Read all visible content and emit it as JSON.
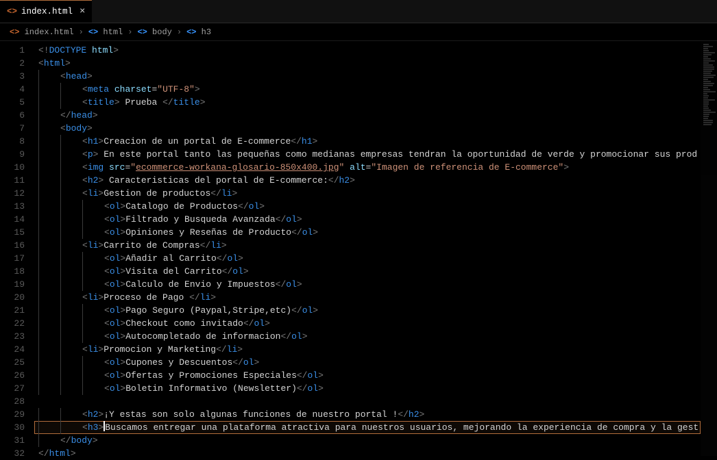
{
  "tab": {
    "filename": "index.html",
    "icon": "<>"
  },
  "breadcrumbs": [
    {
      "kind": "file",
      "icon": "<>",
      "label": "index.html"
    },
    {
      "kind": "el",
      "icon": "<>",
      "label": "html"
    },
    {
      "kind": "el",
      "icon": "<>",
      "label": "body"
    },
    {
      "kind": "el",
      "icon": "<>",
      "label": "h3"
    }
  ],
  "current_line": 30,
  "code": [
    {
      "n": 1,
      "indent": 0,
      "tokens": [
        [
          "brk",
          "<!"
        ],
        [
          "dt",
          "DOCTYPE"
        ],
        [
          "txt",
          " "
        ],
        [
          "attr",
          "html"
        ],
        [
          "brk",
          ">"
        ]
      ]
    },
    {
      "n": 2,
      "indent": 0,
      "tokens": [
        [
          "brk",
          "<"
        ],
        [
          "tag",
          "html"
        ],
        [
          "brk",
          ">"
        ]
      ]
    },
    {
      "n": 3,
      "indent": 1,
      "tokens": [
        [
          "brk",
          "<"
        ],
        [
          "tag",
          "head"
        ],
        [
          "brk",
          ">"
        ]
      ]
    },
    {
      "n": 4,
      "indent": 2,
      "tokens": [
        [
          "brk",
          "<"
        ],
        [
          "tag",
          "meta"
        ],
        [
          "txt",
          " "
        ],
        [
          "attr",
          "charset"
        ],
        [
          "eq",
          "="
        ],
        [
          "str",
          "\"UTF-8\""
        ],
        [
          "brk",
          ">"
        ]
      ]
    },
    {
      "n": 5,
      "indent": 2,
      "tokens": [
        [
          "brk",
          "<"
        ],
        [
          "tag",
          "title"
        ],
        [
          "brk",
          ">"
        ],
        [
          "txt",
          " Prueba "
        ],
        [
          "brk",
          "</"
        ],
        [
          "tag",
          "title"
        ],
        [
          "brk",
          ">"
        ]
      ]
    },
    {
      "n": 6,
      "indent": 1,
      "tokens": [
        [
          "brk",
          "</"
        ],
        [
          "tag",
          "head"
        ],
        [
          "brk",
          ">"
        ]
      ]
    },
    {
      "n": 7,
      "indent": 1,
      "tokens": [
        [
          "brk",
          "<"
        ],
        [
          "tag",
          "body"
        ],
        [
          "brk",
          ">"
        ]
      ]
    },
    {
      "n": 8,
      "indent": 2,
      "tokens": [
        [
          "brk",
          "<"
        ],
        [
          "tag",
          "h1"
        ],
        [
          "brk",
          ">"
        ],
        [
          "txt",
          "Creacion de un portal de E-commerce"
        ],
        [
          "brk",
          "</"
        ],
        [
          "tag",
          "h1"
        ],
        [
          "brk",
          ">"
        ]
      ]
    },
    {
      "n": 9,
      "indent": 2,
      "tokens": [
        [
          "brk",
          "<"
        ],
        [
          "tag",
          "p"
        ],
        [
          "brk",
          ">"
        ],
        [
          "txt",
          " En este portal tanto las pequeñas como medianas empresas tendran la oportunidad de verde y promocionar sus prod"
        ]
      ]
    },
    {
      "n": 10,
      "indent": 2,
      "tokens": [
        [
          "brk",
          "<"
        ],
        [
          "tag",
          "img"
        ],
        [
          "txt",
          " "
        ],
        [
          "attr",
          "src"
        ],
        [
          "eq",
          "="
        ],
        [
          "str",
          "\""
        ],
        [
          "str-link",
          "ecommerce-workana-glosario-850x400.jpg"
        ],
        [
          "str",
          "\""
        ],
        [
          "txt",
          " "
        ],
        [
          "attr",
          "alt"
        ],
        [
          "eq",
          "="
        ],
        [
          "str",
          "\"Imagen de referencia de E-commerce\""
        ],
        [
          "brk",
          ">"
        ]
      ]
    },
    {
      "n": 11,
      "indent": 2,
      "tokens": [
        [
          "brk",
          "<"
        ],
        [
          "tag",
          "h2"
        ],
        [
          "brk",
          ">"
        ],
        [
          "txt",
          " Caracteristicas del portal de E-commerce:"
        ],
        [
          "brk",
          "</"
        ],
        [
          "tag",
          "h2"
        ],
        [
          "brk",
          ">"
        ]
      ]
    },
    {
      "n": 12,
      "indent": 2,
      "tokens": [
        [
          "brk",
          "<"
        ],
        [
          "tag",
          "li"
        ],
        [
          "brk",
          ">"
        ],
        [
          "txt",
          "Gestion de productos"
        ],
        [
          "brk",
          "</"
        ],
        [
          "tag",
          "li"
        ],
        [
          "brk",
          ">"
        ]
      ]
    },
    {
      "n": 13,
      "indent": 3,
      "tokens": [
        [
          "brk",
          "<"
        ],
        [
          "tag",
          "ol"
        ],
        [
          "brk",
          ">"
        ],
        [
          "txt",
          "Catalogo de Productos"
        ],
        [
          "brk",
          "</"
        ],
        [
          "tag",
          "ol"
        ],
        [
          "brk",
          ">"
        ]
      ]
    },
    {
      "n": 14,
      "indent": 3,
      "tokens": [
        [
          "brk",
          "<"
        ],
        [
          "tag",
          "ol"
        ],
        [
          "brk",
          ">"
        ],
        [
          "txt",
          "Filtrado y Busqueda Avanzada"
        ],
        [
          "brk",
          "</"
        ],
        [
          "tag",
          "ol"
        ],
        [
          "brk",
          ">"
        ]
      ]
    },
    {
      "n": 15,
      "indent": 3,
      "tokens": [
        [
          "brk",
          "<"
        ],
        [
          "tag",
          "ol"
        ],
        [
          "brk",
          ">"
        ],
        [
          "txt",
          "Opiniones y Reseñas de Producto"
        ],
        [
          "brk",
          "</"
        ],
        [
          "tag",
          "ol"
        ],
        [
          "brk",
          ">"
        ]
      ]
    },
    {
      "n": 16,
      "indent": 2,
      "tokens": [
        [
          "brk",
          "<"
        ],
        [
          "tag",
          "li"
        ],
        [
          "brk",
          ">"
        ],
        [
          "txt",
          "Carrito de Compras"
        ],
        [
          "brk",
          "</"
        ],
        [
          "tag",
          "li"
        ],
        [
          "brk",
          ">"
        ]
      ]
    },
    {
      "n": 17,
      "indent": 3,
      "tokens": [
        [
          "brk",
          "<"
        ],
        [
          "tag",
          "ol"
        ],
        [
          "brk",
          ">"
        ],
        [
          "txt",
          "Añadir al Carrito"
        ],
        [
          "brk",
          "</"
        ],
        [
          "tag",
          "ol"
        ],
        [
          "brk",
          ">"
        ]
      ]
    },
    {
      "n": 18,
      "indent": 3,
      "tokens": [
        [
          "brk",
          "<"
        ],
        [
          "tag",
          "ol"
        ],
        [
          "brk",
          ">"
        ],
        [
          "txt",
          "Visita del Carrito"
        ],
        [
          "brk",
          "</"
        ],
        [
          "tag",
          "ol"
        ],
        [
          "brk",
          ">"
        ]
      ]
    },
    {
      "n": 19,
      "indent": 3,
      "tokens": [
        [
          "brk",
          "<"
        ],
        [
          "tag",
          "ol"
        ],
        [
          "brk",
          ">"
        ],
        [
          "txt",
          "Calculo de Envio y Impuestos"
        ],
        [
          "brk",
          "</"
        ],
        [
          "tag",
          "ol"
        ],
        [
          "brk",
          ">"
        ]
      ]
    },
    {
      "n": 20,
      "indent": 2,
      "tokens": [
        [
          "brk",
          "<"
        ],
        [
          "tag",
          "li"
        ],
        [
          "brk",
          ">"
        ],
        [
          "txt",
          "Proceso de Pago "
        ],
        [
          "brk",
          "</"
        ],
        [
          "tag",
          "li"
        ],
        [
          "brk",
          ">"
        ]
      ]
    },
    {
      "n": 21,
      "indent": 3,
      "tokens": [
        [
          "brk",
          "<"
        ],
        [
          "tag",
          "ol"
        ],
        [
          "brk",
          ">"
        ],
        [
          "txt",
          "Pago Seguro (Paypal,Stripe,etc)"
        ],
        [
          "brk",
          "</"
        ],
        [
          "tag",
          "ol"
        ],
        [
          "brk",
          ">"
        ]
      ]
    },
    {
      "n": 22,
      "indent": 3,
      "tokens": [
        [
          "brk",
          "<"
        ],
        [
          "tag",
          "ol"
        ],
        [
          "brk",
          ">"
        ],
        [
          "txt",
          "Checkout como invitado"
        ],
        [
          "brk",
          "</"
        ],
        [
          "tag",
          "ol"
        ],
        [
          "brk",
          ">"
        ]
      ]
    },
    {
      "n": 23,
      "indent": 3,
      "tokens": [
        [
          "brk",
          "<"
        ],
        [
          "tag",
          "ol"
        ],
        [
          "brk",
          ">"
        ],
        [
          "txt",
          "Autocompletado de informacion"
        ],
        [
          "brk",
          "</"
        ],
        [
          "tag",
          "ol"
        ],
        [
          "brk",
          ">"
        ]
      ]
    },
    {
      "n": 24,
      "indent": 2,
      "tokens": [
        [
          "brk",
          "<"
        ],
        [
          "tag",
          "li"
        ],
        [
          "brk",
          ">"
        ],
        [
          "txt",
          "Promocion y Marketing"
        ],
        [
          "brk",
          "</"
        ],
        [
          "tag",
          "li"
        ],
        [
          "brk",
          ">"
        ]
      ]
    },
    {
      "n": 25,
      "indent": 3,
      "tokens": [
        [
          "brk",
          "<"
        ],
        [
          "tag",
          "ol"
        ],
        [
          "brk",
          ">"
        ],
        [
          "txt",
          "Cupones y Descuentos"
        ],
        [
          "brk",
          "</"
        ],
        [
          "tag",
          "ol"
        ],
        [
          "brk",
          ">"
        ]
      ]
    },
    {
      "n": 26,
      "indent": 3,
      "tokens": [
        [
          "brk",
          "<"
        ],
        [
          "tag",
          "ol"
        ],
        [
          "brk",
          ">"
        ],
        [
          "txt",
          "Ofertas y Promociones Especiales"
        ],
        [
          "brk",
          "</"
        ],
        [
          "tag",
          "ol"
        ],
        [
          "brk",
          ">"
        ]
      ]
    },
    {
      "n": 27,
      "indent": 3,
      "tokens": [
        [
          "brk",
          "<"
        ],
        [
          "tag",
          "ol"
        ],
        [
          "brk",
          ">"
        ],
        [
          "txt",
          "Boletin Informativo (Newsletter)"
        ],
        [
          "brk",
          "</"
        ],
        [
          "tag",
          "ol"
        ],
        [
          "brk",
          ">"
        ]
      ]
    },
    {
      "n": 28,
      "indent": 0,
      "tokens": []
    },
    {
      "n": 29,
      "indent": 2,
      "tokens": [
        [
          "brk",
          "<"
        ],
        [
          "tag",
          "h2"
        ],
        [
          "brk",
          ">"
        ],
        [
          "txt",
          "¡Y estas son solo algunas funciones de nuestro portal !"
        ],
        [
          "brk",
          "</"
        ],
        [
          "tag",
          "h2"
        ],
        [
          "brk",
          ">"
        ]
      ]
    },
    {
      "n": 30,
      "indent": 2,
      "tokens": [
        [
          "brk",
          "<"
        ],
        [
          "tag",
          "h3"
        ],
        [
          "brk",
          ">"
        ],
        [
          "cursor",
          ""
        ],
        [
          "txt",
          "Buscamos entregar una plataforma atractiva para nuestros usuarios, mejorando la experiencia de compra y la gest"
        ]
      ]
    },
    {
      "n": 31,
      "indent": 1,
      "tokens": [
        [
          "brk",
          "</"
        ],
        [
          "tag",
          "body"
        ],
        [
          "brk",
          ">"
        ]
      ]
    },
    {
      "n": 32,
      "indent": 0,
      "tokens": [
        [
          "brk",
          "</"
        ],
        [
          "tag",
          "html"
        ],
        [
          "brk",
          ">"
        ]
      ]
    }
  ]
}
